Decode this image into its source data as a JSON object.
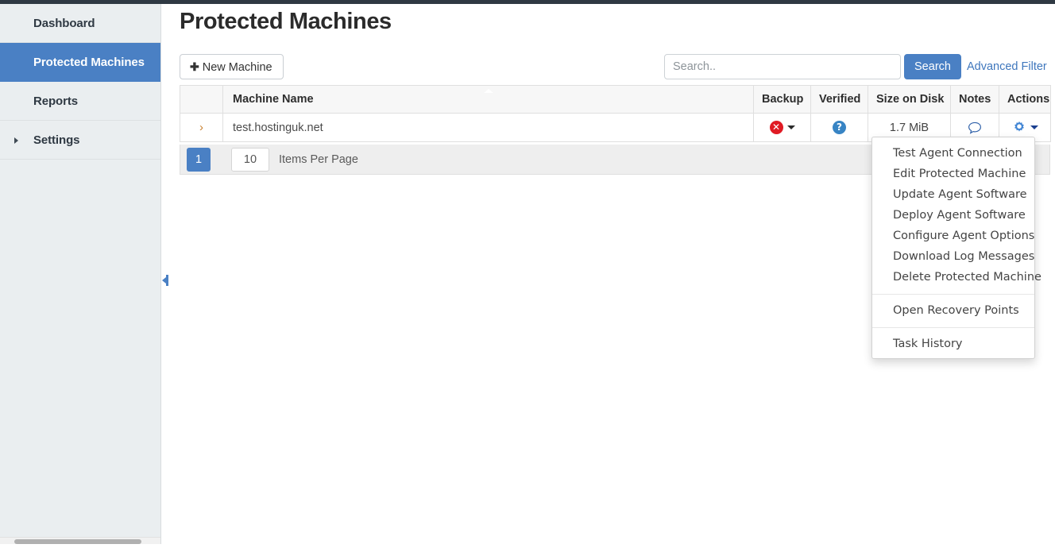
{
  "app": {
    "accent_color": "#4a80c4",
    "topbar_color": "#2f3943",
    "sidebar_bg": "#eaeef0"
  },
  "sidebar": {
    "items": [
      {
        "label": "Dashboard",
        "active": false,
        "has_caret": false
      },
      {
        "label": "Protected Machines",
        "active": true,
        "has_caret": false
      },
      {
        "label": "Reports",
        "active": false,
        "has_caret": false
      },
      {
        "label": "Settings",
        "active": false,
        "has_caret": true
      }
    ]
  },
  "page": {
    "title": "Protected Machines"
  },
  "toolbar": {
    "new_machine_label": "New Machine",
    "new_machine_icon": "plus-icon",
    "search_placeholder": "Search..",
    "search_value": "",
    "search_button_label": "Search",
    "advanced_filter_label": "Advanced Filter"
  },
  "table": {
    "sort_column": "Machine Name",
    "sort_direction": "asc",
    "columns": [
      {
        "key": "expand",
        "label": ""
      },
      {
        "key": "name",
        "label": "Machine Name"
      },
      {
        "key": "backup",
        "label": "Backup"
      },
      {
        "key": "verified",
        "label": "Verified"
      },
      {
        "key": "size",
        "label": "Size on Disk"
      },
      {
        "key": "notes",
        "label": "Notes"
      },
      {
        "key": "actions",
        "label": "Actions"
      }
    ],
    "rows": [
      {
        "expand_icon": "chevron-right-icon",
        "name": "test.hostinguk.net",
        "backup_icon": "error-circle-icon",
        "backup_status_color": "#e01b24",
        "backup_status": "error",
        "verified_icon": "question-circle-icon",
        "verified_status_color": "#3784c4",
        "verified_status": "unknown",
        "size": "1.7 MiB",
        "notes_icon": "comment-icon",
        "actions_icon": "gear-icon"
      }
    ]
  },
  "pager": {
    "current_page": "1",
    "items_per_page": "10",
    "items_per_page_label": "Items Per Page"
  },
  "actions_menu": {
    "open": true,
    "groups": [
      {
        "items": [
          "Test Agent Connection",
          "Edit Protected Machine",
          "Update Agent Software",
          "Deploy Agent Software",
          "Configure Agent Options",
          "Download Log Messages",
          "Delete Protected Machine"
        ]
      },
      {
        "items": [
          "Open Recovery Points"
        ]
      },
      {
        "items": [
          "Task History"
        ]
      }
    ]
  }
}
